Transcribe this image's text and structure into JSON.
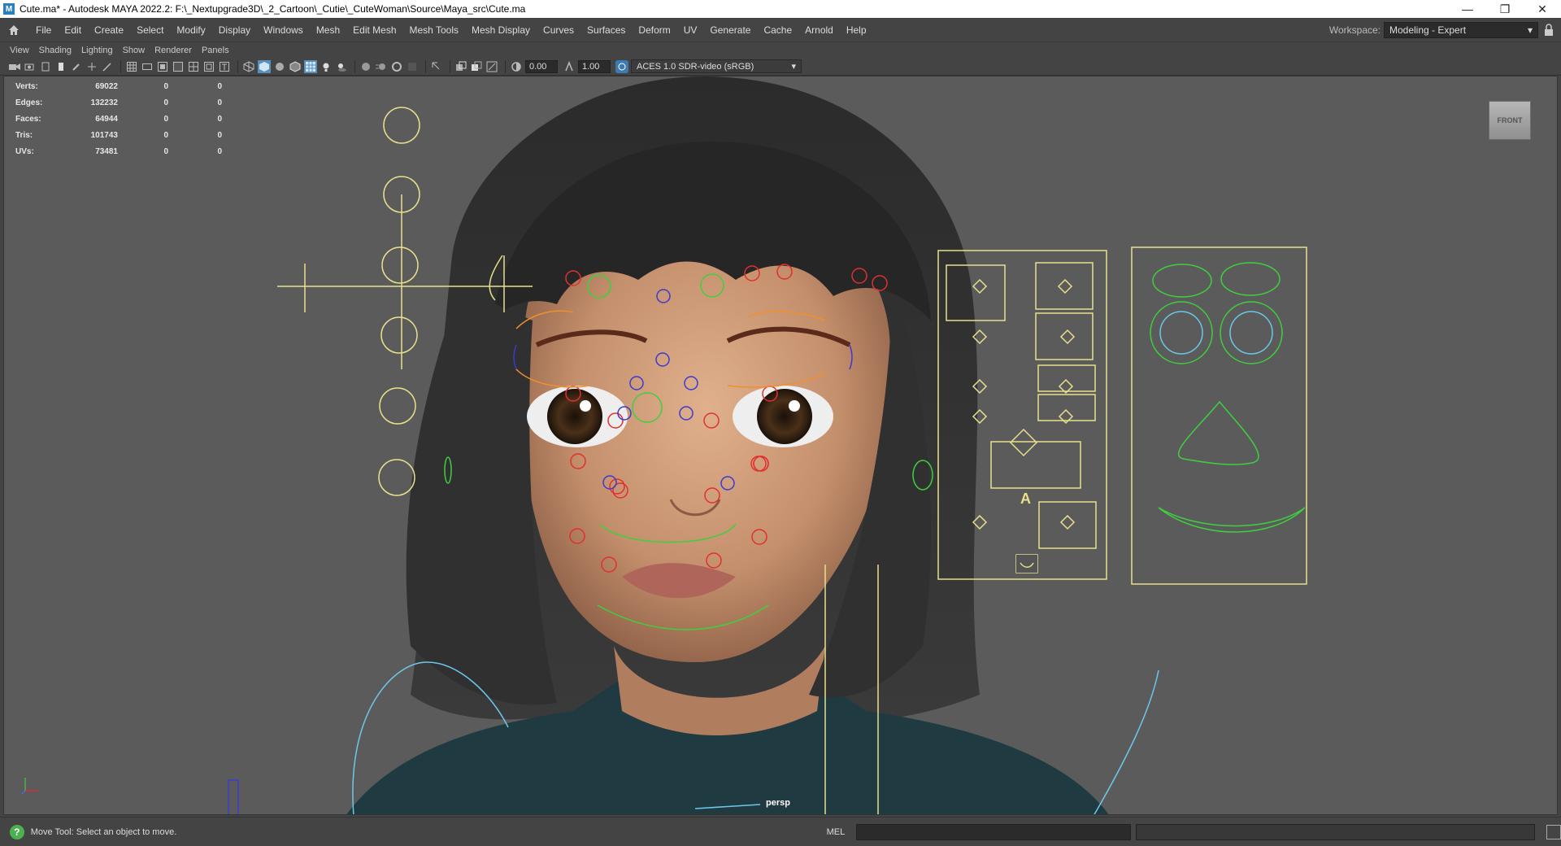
{
  "window": {
    "title": "Cute.ma* - Autodesk MAYA 2022.2: F:\\_Nextupgrade3D\\_2_Cartoon\\_Cutie\\_CuteWoman\\Source\\Maya_src\\Cute.ma",
    "app_icon_letter": "M",
    "minimize": "—",
    "restore": "❐",
    "close": "✕"
  },
  "menubar": {
    "items": [
      "File",
      "Edit",
      "Create",
      "Select",
      "Modify",
      "Display",
      "Windows",
      "Mesh",
      "Edit Mesh",
      "Mesh Tools",
      "Mesh Display",
      "Curves",
      "Surfaces",
      "Deform",
      "UV",
      "Generate",
      "Cache",
      "Arnold",
      "Help"
    ],
    "workspace_label": "Workspace:",
    "workspace_value": "Modeling - Expert"
  },
  "panel_menu": {
    "items": [
      "View",
      "Shading",
      "Lighting",
      "Show",
      "Renderer",
      "Panels"
    ]
  },
  "panel_toolbar": {
    "field_a": "0.00",
    "field_b": "1.00",
    "color_space": "ACES 1.0 SDR-video (sRGB)"
  },
  "hud": {
    "rows": [
      {
        "label": "Verts:",
        "v1": "69022",
        "v2": "0",
        "v3": "0"
      },
      {
        "label": "Edges:",
        "v1": "132232",
        "v2": "0",
        "v3": "0"
      },
      {
        "label": "Faces:",
        "v1": "64944",
        "v2": "0",
        "v3": "0"
      },
      {
        "label": "Tris:",
        "v1": "101743",
        "v2": "0",
        "v3": "0"
      },
      {
        "label": "UVs:",
        "v1": "73481",
        "v2": "0",
        "v3": "0"
      }
    ]
  },
  "viewport": {
    "viewcube_label": "FRONT",
    "camera": "persp",
    "ui_panel_glyph": "A"
  },
  "statusbar": {
    "help_glyph": "?",
    "message": "Move Tool: Select an object to move.",
    "lang": "MEL"
  },
  "colors": {
    "ctrl_yellow": "#e8e08c",
    "ctrl_green": "#3fcf3f",
    "ctrl_red": "#e03030",
    "ctrl_blue": "#3a3acf",
    "ctrl_cyan": "#6cc8e8",
    "ctrl_orange": "#f0902a"
  }
}
